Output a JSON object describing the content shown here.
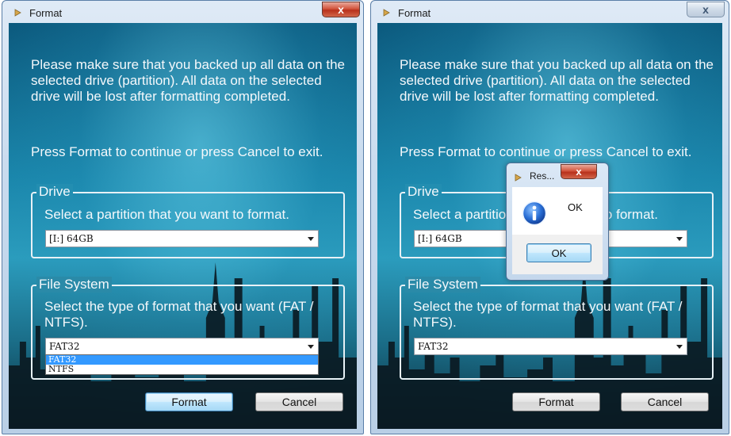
{
  "left_window": {
    "title": "Format",
    "close_glyph": "x",
    "message": "Please make sure that you backed up all data on the selected drive (partition).  All data on the selected drive will be lost after formatting completed.",
    "instruction": "Press Format to continue or press Cancel to exit.",
    "drive_group": {
      "legend": "Drive",
      "description": "Select a partition that you want to format.",
      "selected": "[I:] 64GB"
    },
    "fs_group": {
      "legend": "File System",
      "description": "Select the type of format that you want (FAT / NTFS).",
      "selected": "FAT32",
      "options": [
        "FAT32",
        "NTFS"
      ],
      "dropdown_open": true
    },
    "format_button": "Format",
    "cancel_button": "Cancel"
  },
  "right_window": {
    "title": "Format",
    "close_glyph": "x",
    "message": "Please make sure that you backed up all data on the selected drive (partition).  All data on the selected drive will be lost after formatting completed.",
    "instruction": "Press Format to continue or press Cancel to exit.",
    "drive_group": {
      "legend": "Drive",
      "description": "Select a partition that you want to format.",
      "selected": "[I:] 64GB"
    },
    "fs_group": {
      "legend": "File System",
      "description": "Select the type of format that you want (FAT / NTFS).",
      "selected": "FAT32"
    },
    "format_button": "Format",
    "cancel_button": "Cancel"
  },
  "message_box": {
    "title": "Res...",
    "close_glyph": "x",
    "icon": "info-icon",
    "text": "OK",
    "ok_button": "OK"
  },
  "colors": {
    "sky_top": "#0c5a7e",
    "sky_mid": "#2b9cbd",
    "selection": "#3399ff",
    "close_red": "#c8452e"
  }
}
